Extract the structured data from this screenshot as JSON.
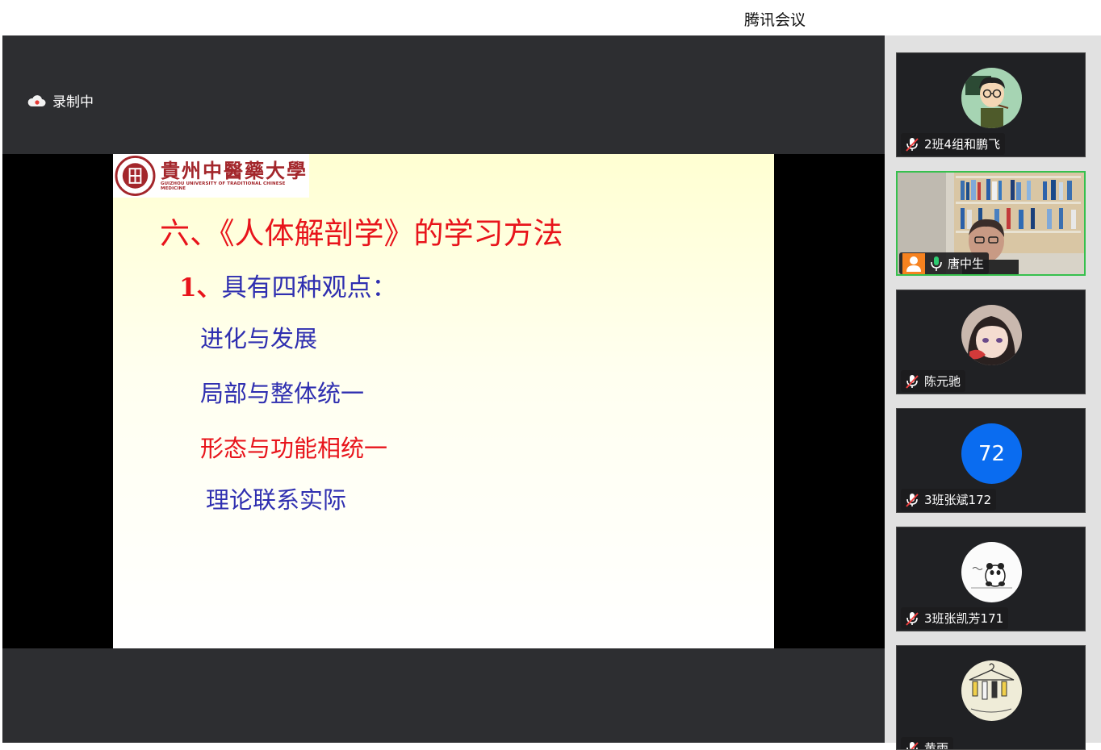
{
  "app": {
    "title": "腾讯会议"
  },
  "recording": {
    "label": "录制中"
  },
  "slide": {
    "logo_cn": "貴州中醫藥大學",
    "logo_en": "GUIZHOU UNIVERSITY OF TRADITIONAL CHINESE MEDICINE",
    "title": "六、《人体解剖学》的学习方法",
    "subtitle_num": "1、",
    "subtitle_text": "具有四种观点：",
    "points": [
      "进化与发展",
      "局部与整体统一",
      "形态与功能相统一",
      "理论联系实际"
    ],
    "colors": {
      "title": "#e8141b",
      "text": "#2f2fb0"
    }
  },
  "participants": [
    {
      "name": "2班4组和鹏飞",
      "mic": "muted",
      "avatar": "cartoon-teacher"
    },
    {
      "name": "唐中生",
      "mic": "active",
      "avatar": "video",
      "active": true
    },
    {
      "name": "陈元驰",
      "mic": "muted",
      "avatar": "anime-girl"
    },
    {
      "name": "3班张斌172",
      "mic": "muted",
      "avatar": "initials",
      "initials": "72"
    },
    {
      "name": "3班张凯芳171",
      "mic": "muted",
      "avatar": "panda-sketch"
    },
    {
      "name": "黄雨",
      "mic": "muted",
      "avatar": "hanger-sketch"
    }
  ]
}
